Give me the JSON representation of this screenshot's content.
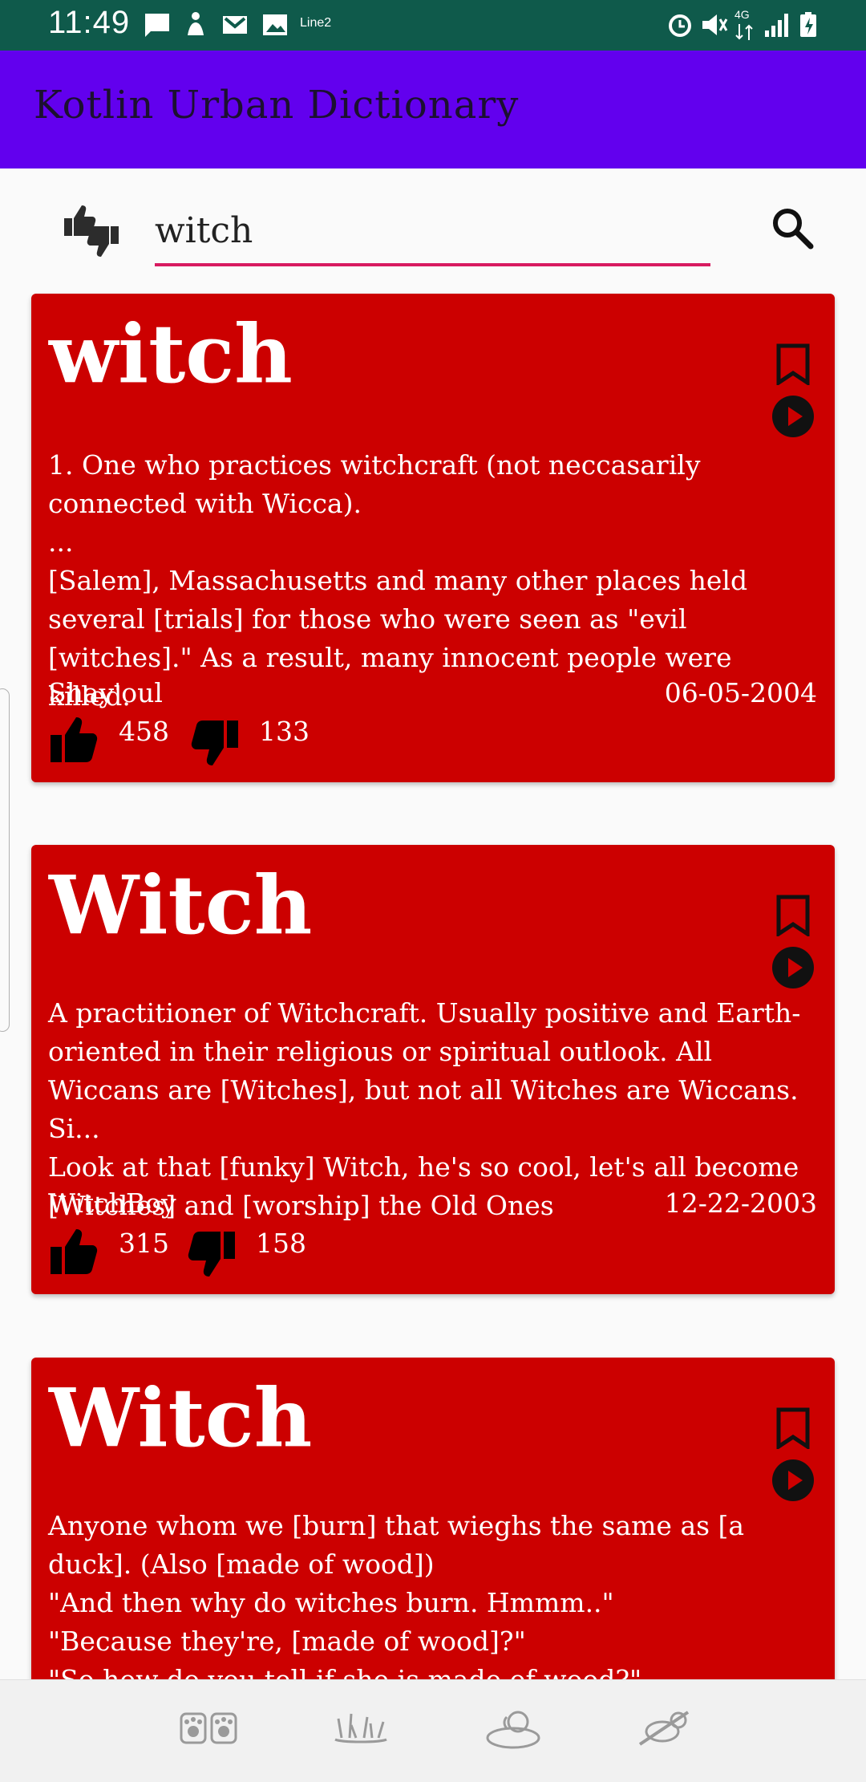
{
  "status_bar": {
    "time": "11:49",
    "carrier_label": "Line2",
    "network_label": "4G"
  },
  "app_bar": {
    "title": "Kotlin Urban Dictionary"
  },
  "search": {
    "value": "witch",
    "sort_icon": "thumbs-up-down-icon",
    "search_icon": "search-icon"
  },
  "cards": [
    {
      "word": "witch",
      "definition": "1. One who practices witchcraft (not neccasarily connected with Wicca).\n ...\n[Salem], Massachusetts and many other places held several [trials] for those who were seen as \"evil [witches].\" As a result, many innocent people were killed.",
      "author": "Shay'oul",
      "date": "06-05-2004",
      "thumbs_up": "458",
      "thumbs_down": "133"
    },
    {
      "word": "Witch",
      "definition": "A practitioner of Witchcraft. Usually positive and Earth-oriented in their religious or spiritual outlook. All Wiccans are [Witches], but not all Witches are Wiccans. Si...\nLook at that [funky] Witch, he's so cool, let's all become [Witches] and [worship] the Old Ones",
      "author": "WitchBoy",
      "date": "12-22-2003",
      "thumbs_up": "315",
      "thumbs_down": "158"
    },
    {
      "word": "Witch",
      "definition": "Anyone whom we [burn] that wieghs the same as [a duck]. (Also [made of wood])\n\"And then why do witches burn. Hmmm..\"\n\"Because they're, [made of wood]?\"\n\"So how do you tell if she is made of wood?\""
    }
  ],
  "bottom_nav": {
    "items": [
      "paws-icon",
      "grass-icon",
      "dog-bed-icon",
      "sleeping-dog-icon"
    ]
  }
}
